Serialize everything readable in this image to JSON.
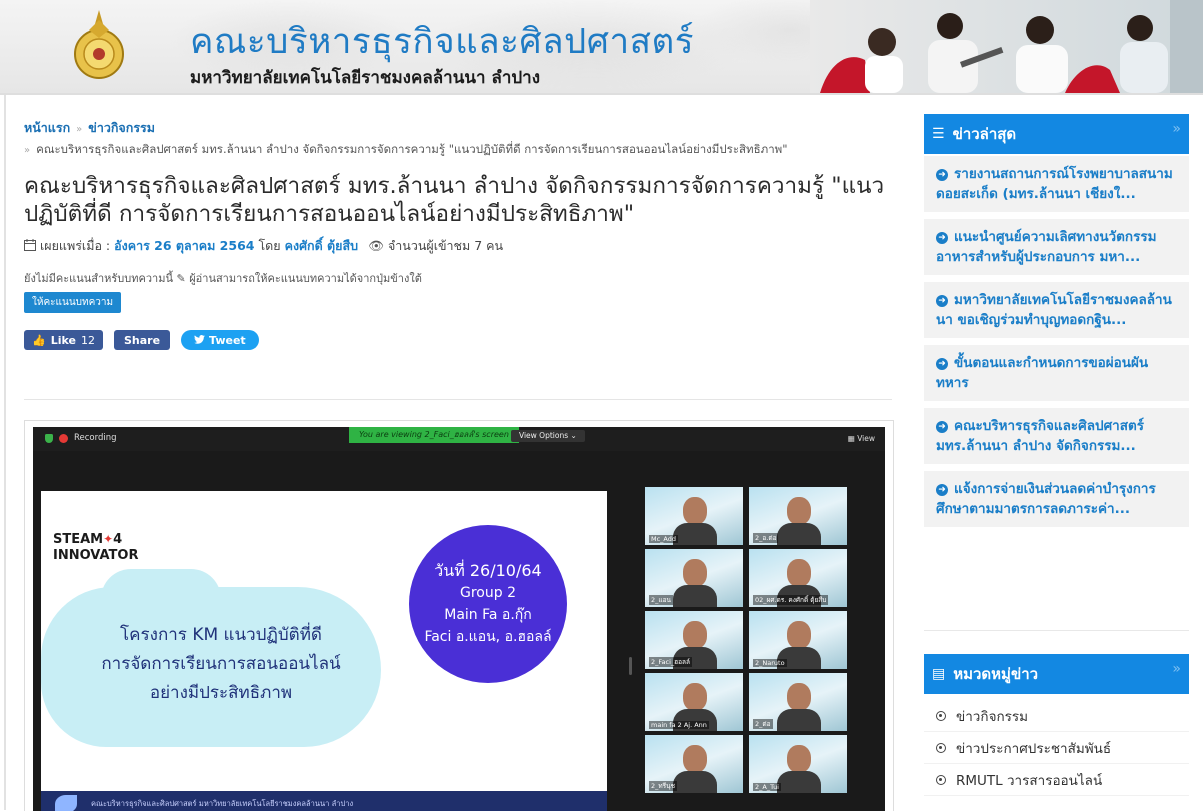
{
  "header": {
    "faculty_name": "คณะบริหารธุรกิจและศิลปศาสตร์",
    "university_name": "มหาวิทยาลัยเทคโนโลยีราชมงคลล้านนา ลำปาง"
  },
  "breadcrumb": {
    "home": "หน้าแรก",
    "section": "ข่าวกิจกรรม",
    "current": "คณะบริหารธุรกิจและศิลปศาสตร์ มทร.ล้านนา ลำปาง จัดกิจกรรมการจัดการความรู้ \"แนวปฏิบัติที่ดี การจัดการเรียนการสอนออนไลน์อย่างมีประสิทธิภาพ\""
  },
  "article": {
    "title": "คณะบริหารธุรกิจและศิลปศาสตร์ มทร.ล้านนา ลำปาง จัดกิจกรรมการจัดการความรู้ \"แนวปฏิบัติที่ดี การจัดการเรียนการสอนออนไลน์อย่างมีประสิทธิภาพ\"",
    "published_label": "เผยแพร่เมื่อ :",
    "published_date": "อังคาร 26 ตุลาคม 2564",
    "by_label": "โดย",
    "author": "คงศักดิ์ ตุ้ยสืบ",
    "views_label": "จำนวนผู้เข้าชม 7 คน",
    "rating_text": "ยังไม่มีคะแนนสำหรับบทความนี้",
    "rating_hint": "ผู้อ่านสามารถให้คะแนนบทความได้จากปุ่มข้างใต้",
    "rate_button": "ให้คะแนนบทความ"
  },
  "social": {
    "like_label": "Like",
    "like_count": "12",
    "share_label": "Share",
    "tweet_label": "Tweet"
  },
  "zoom": {
    "recording": "Recording",
    "viewing": "You are viewing 2_Faci_ฮอลล์'s screen",
    "view_options": "View Options ⌄",
    "view": "View",
    "slide": {
      "logo_line1": "STEAM",
      "logo_suffix": "4",
      "logo_line2": "INNOVATOR",
      "km_line1": "โครงการ KM แนวปฏิบัติที่ดี",
      "km_line2": "การจัดการเรียนการสอนออนไลน์",
      "km_line3": "อย่างมีประสิทธิภาพ",
      "date": "วันที่ 26/10/64",
      "group": "Group 2",
      "main_fa": "Main Fa อ.กุ๊ก",
      "faci": "Faci อ.แอน, อ.ฮอลล์",
      "footer": "คณะบริหารธุรกิจและศิลปศาสตร์ มหาวิทยาลัยเทคโนโลยีราชมงคลล้านนา ลำปาง"
    },
    "participants": [
      "Mc_Add",
      "2_อ.ต่อ",
      "2_แอน",
      "02_ผศ.ดร. คงศักดิ์ ตุ้ยสืบ",
      "2_Faci_ฮอลล์",
      "2_Naruto",
      "main fa 2 Aj. Ann",
      "2_ต่อ",
      "2_ทรีนุช",
      "2_A_Tui"
    ]
  },
  "sidebar": {
    "latest_title": "ข่าวล่าสุด",
    "latest": [
      "รายงานสถานการณ์โรงพยาบาลสนามดอยสะเก็ด (มทร.ล้านนา เชียงใ...",
      "แนะนำศูนย์ความเลิศทางนวัตกรรมอาหารสำหรับผู้ประกอบการ มหา...",
      "มหาวิทยาลัยเทคโนโลยีราชมงคลล้านนา ขอเชิญร่วมทำบุญทอดกฐิน...",
      "ขั้นตอนและกำหนดการขอผ่อนผันทหาร",
      "คณะบริหารธุรกิจและศิลปศาสตร์ มทร.ล้านนา ลำปาง จัดกิจกรรม...",
      "แจ้งการจ่ายเงินส่วนลดค่าบำรุงการศึกษาตามมาตรการลดภาระค่า..."
    ],
    "category_title": "หมวดหมู่ข่าว",
    "categories": [
      "ข่าวกิจกรรม",
      "ข่าวประกาศประชาสัมพันธ์",
      "RMUTL วารสารออนไลน์"
    ]
  },
  "colors": {
    "accent": "#1388e2",
    "link": "#1a7ec8",
    "facebook": "#3b5998",
    "twitter": "#1da1f2"
  }
}
